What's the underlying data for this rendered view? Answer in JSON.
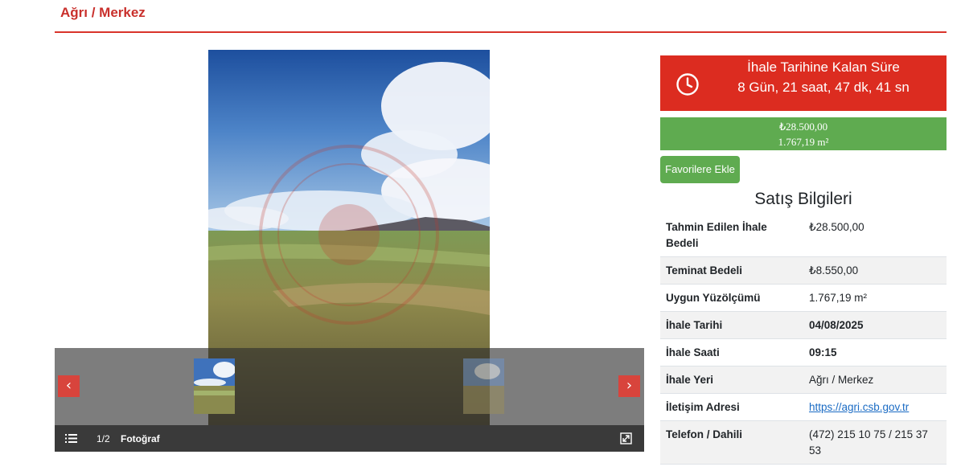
{
  "header": {
    "title": "Ağrı / Merkez"
  },
  "gallery": {
    "prev_arrow": "‹",
    "next_arrow": "›",
    "counter": "1/2",
    "caption": "Fotoğraf"
  },
  "countdown": {
    "title": "İhale Tarihine Kalan Süre",
    "value": "8 Gün, 21 saat, 47 dk, 41 sn"
  },
  "price": {
    "amount": "₺28.500,00",
    "area": "1.767,19 m²"
  },
  "favorite_button": "Favorilere Ekle",
  "sales_info": {
    "title": "Satış Bilgileri",
    "rows": [
      {
        "label": "Tahmin Edilen İhale Bedeli",
        "value": "₺28.500,00"
      },
      {
        "label": "Teminat Bedeli",
        "value": "₺8.550,00"
      },
      {
        "label": "Uygun Yüzölçümü",
        "value": "1.767,19 m²"
      },
      {
        "label": "İhale Tarihi",
        "value": "04/08/2025"
      },
      {
        "label": "İhale Saati",
        "value": "09:15"
      },
      {
        "label": "İhale Yeri",
        "value": "Ağrı / Merkez"
      },
      {
        "label": "İletişim Adresi",
        "value": "https://agri.csb.gov.tr"
      },
      {
        "label": "Telefon / Dahili",
        "value": "(472) 215 10 75 / 215 37 53"
      }
    ]
  },
  "colors": {
    "accent_red": "#dc2c20",
    "success_green": "#5fab50",
    "link_blue": "#1a6bc4"
  }
}
